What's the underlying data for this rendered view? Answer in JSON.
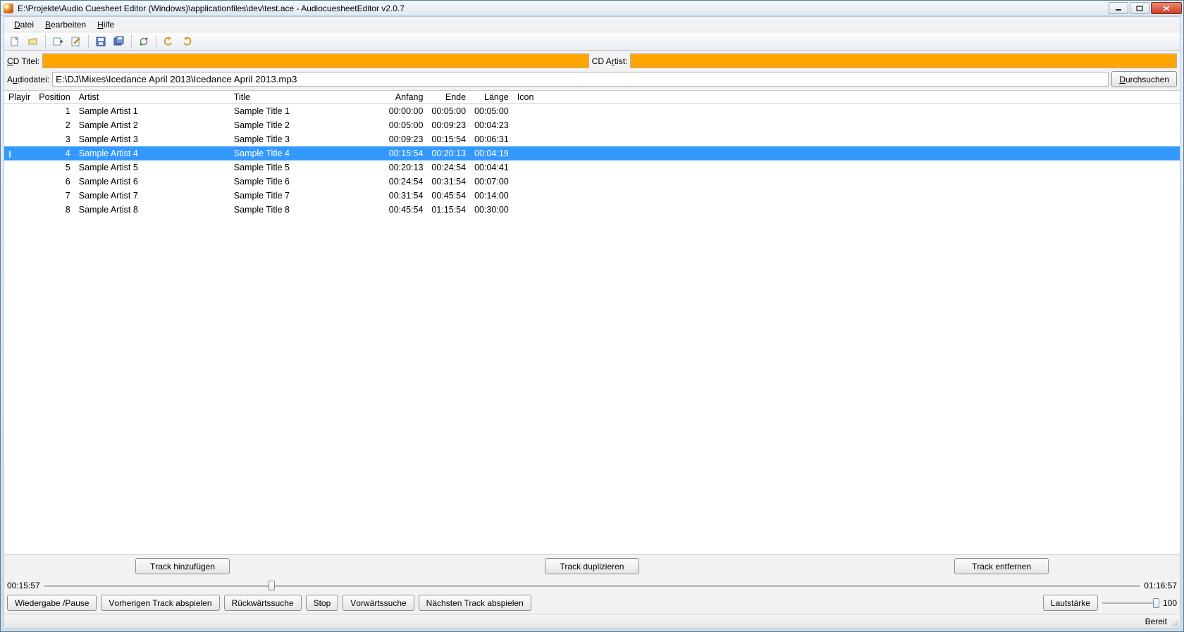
{
  "window": {
    "title": "E:\\Projekte\\Audio Cuesheet Editor (Windows)\\applicationfiles\\dev\\test.ace - AudiocuesheetEditor v2.0.7"
  },
  "menu": {
    "datei": "Datei",
    "bearbeiten": "Bearbeiten",
    "hilfe": "Hilfe"
  },
  "fields": {
    "cd_title_label": "CD Titel:",
    "cd_title_value": "",
    "cd_artist_label": "CD Artist:",
    "cd_artist_value": "",
    "audiofile_label": "Audiodatei:",
    "audiofile_value": "E:\\DJ\\Mixes\\Icedance April 2013\\Icedance April 2013.mp3",
    "browse_label": "Durchsuchen"
  },
  "columns": {
    "playing": "Playir",
    "position": "Position",
    "artist": "Artist",
    "title": "Title",
    "anfang": "Anfang",
    "ende": "Ende",
    "laenge": "Länge",
    "icon": "Icon"
  },
  "tracks": [
    {
      "playing": "",
      "pos": "1",
      "artist": "Sample Artist 1",
      "title": "Sample Title 1",
      "anfang": "00:00:00",
      "ende": "00:05:00",
      "laenge": "00:05:00"
    },
    {
      "playing": "",
      "pos": "2",
      "artist": "Sample Artist 2",
      "title": "Sample Title 2",
      "anfang": "00:05:00",
      "ende": "00:09:23",
      "laenge": "00:04:23"
    },
    {
      "playing": "",
      "pos": "3",
      "artist": "Sample Artist 3",
      "title": "Sample Title 3",
      "anfang": "00:09:23",
      "ende": "00:15:54",
      "laenge": "00:06:31"
    },
    {
      "playing": "||",
      "pos": "4",
      "artist": "Sample Artist 4",
      "title": "Sample Title 4",
      "anfang": "00:15:54",
      "ende": "00:20:13",
      "laenge": "00:04:19",
      "selected": true
    },
    {
      "playing": "",
      "pos": "5",
      "artist": "Sample Artist 5",
      "title": "Sample Title 5",
      "anfang": "00:20:13",
      "ende": "00:24:54",
      "laenge": "00:04:41"
    },
    {
      "playing": "",
      "pos": "6",
      "artist": "Sample Artist 6",
      "title": "Sample Title 6",
      "anfang": "00:24:54",
      "ende": "00:31:54",
      "laenge": "00:07:00"
    },
    {
      "playing": "",
      "pos": "7",
      "artist": "Sample Artist 7",
      "title": "Sample Title 7",
      "anfang": "00:31:54",
      "ende": "00:45:54",
      "laenge": "00:14:00"
    },
    {
      "playing": "",
      "pos": "8",
      "artist": "Sample Artist 8",
      "title": "Sample Title 8",
      "anfang": "00:45:54",
      "ende": "01:15:54",
      "laenge": "00:30:00"
    }
  ],
  "track_actions": {
    "add": "Track hinzufügen",
    "duplicate": "Track duplizieren",
    "remove": "Track entfernen"
  },
  "playback": {
    "current_time": "00:15:57",
    "total_time": "01:16:57",
    "seek_percent": 20.7,
    "volume_label": "Lautstärke",
    "volume_value": "100",
    "volume_percent": 100
  },
  "transport": {
    "play_pause": "Wiedergabe / Pause",
    "prev": "Vorherigen Track abspielen",
    "seek_back": "Rückwärtssuche",
    "stop": "Stop",
    "seek_fwd": "Vorwärtssuche",
    "next": "Nächsten Track abspielen"
  },
  "status": {
    "text": "Bereit"
  }
}
